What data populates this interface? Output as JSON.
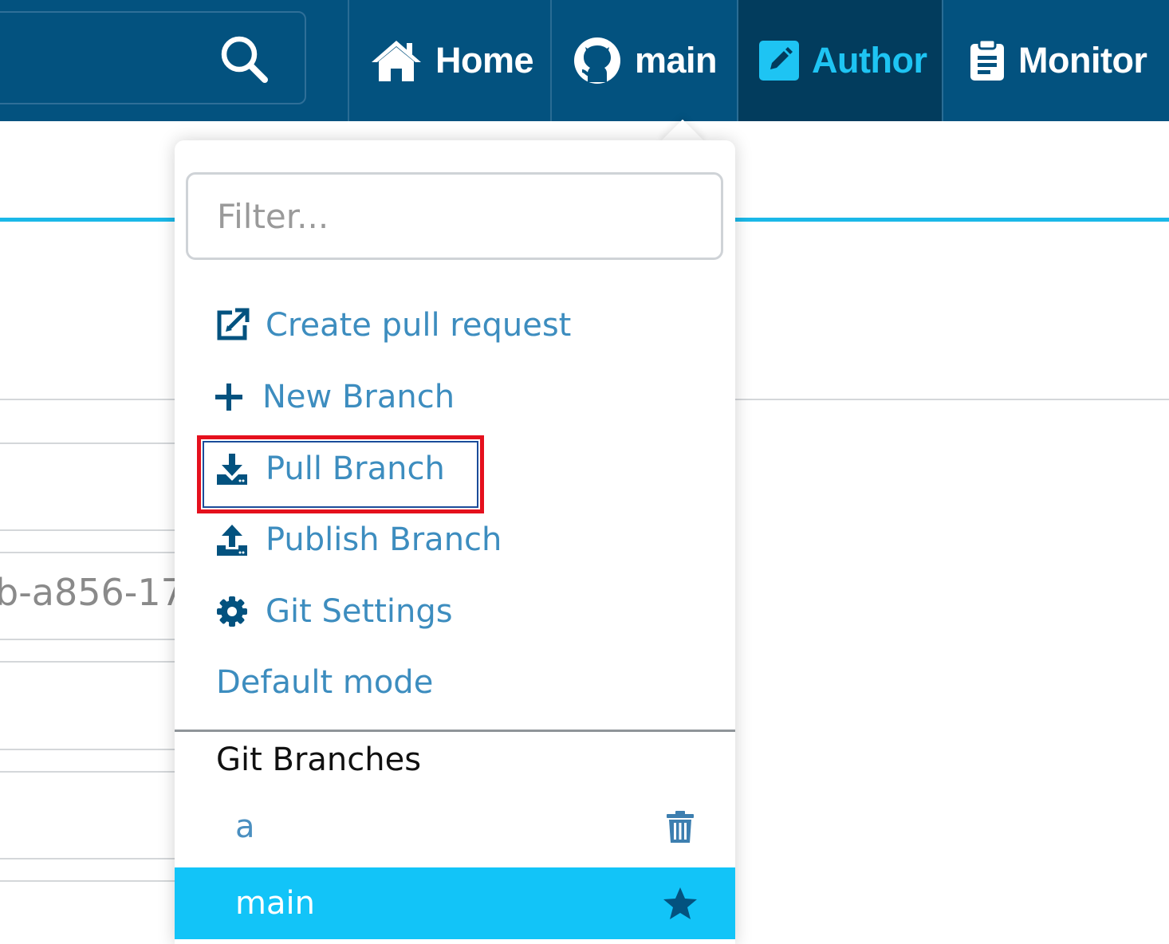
{
  "topbar": {
    "search": {
      "icon": "search-icon"
    },
    "nav": [
      {
        "label": "Home",
        "icon": "home-icon"
      },
      {
        "label": "main",
        "icon": "github-icon"
      },
      {
        "label": "Author",
        "icon": "pencil-square-icon",
        "active": true
      },
      {
        "label": "Monitor",
        "icon": "clipboard-icon"
      }
    ]
  },
  "background": {
    "partial_id_text": "b-a856-17"
  },
  "dropdown": {
    "filter": {
      "placeholder": "Filter...",
      "value": ""
    },
    "actions": [
      {
        "label": "Create pull request",
        "icon": "external-link-icon"
      },
      {
        "label": "New Branch",
        "icon": "plus-icon"
      },
      {
        "label": "Pull Branch",
        "icon": "download-icon",
        "highlighted": true
      },
      {
        "label": "Publish Branch",
        "icon": "upload-icon"
      },
      {
        "label": "Git Settings",
        "icon": "gear-icon"
      },
      {
        "label": "Default mode",
        "icon": ""
      }
    ],
    "branches_title": "Git Branches",
    "branches": [
      {
        "name": "a",
        "icon": "trash-icon",
        "selected": false
      },
      {
        "name": "main",
        "icon": "star-icon",
        "selected": true
      }
    ]
  },
  "colors": {
    "topbar": "#03527f",
    "active_nav": "#023c5d",
    "accent": "#12c4f8",
    "link": "#3d8dbf",
    "highlight_border": "#e5101d"
  }
}
